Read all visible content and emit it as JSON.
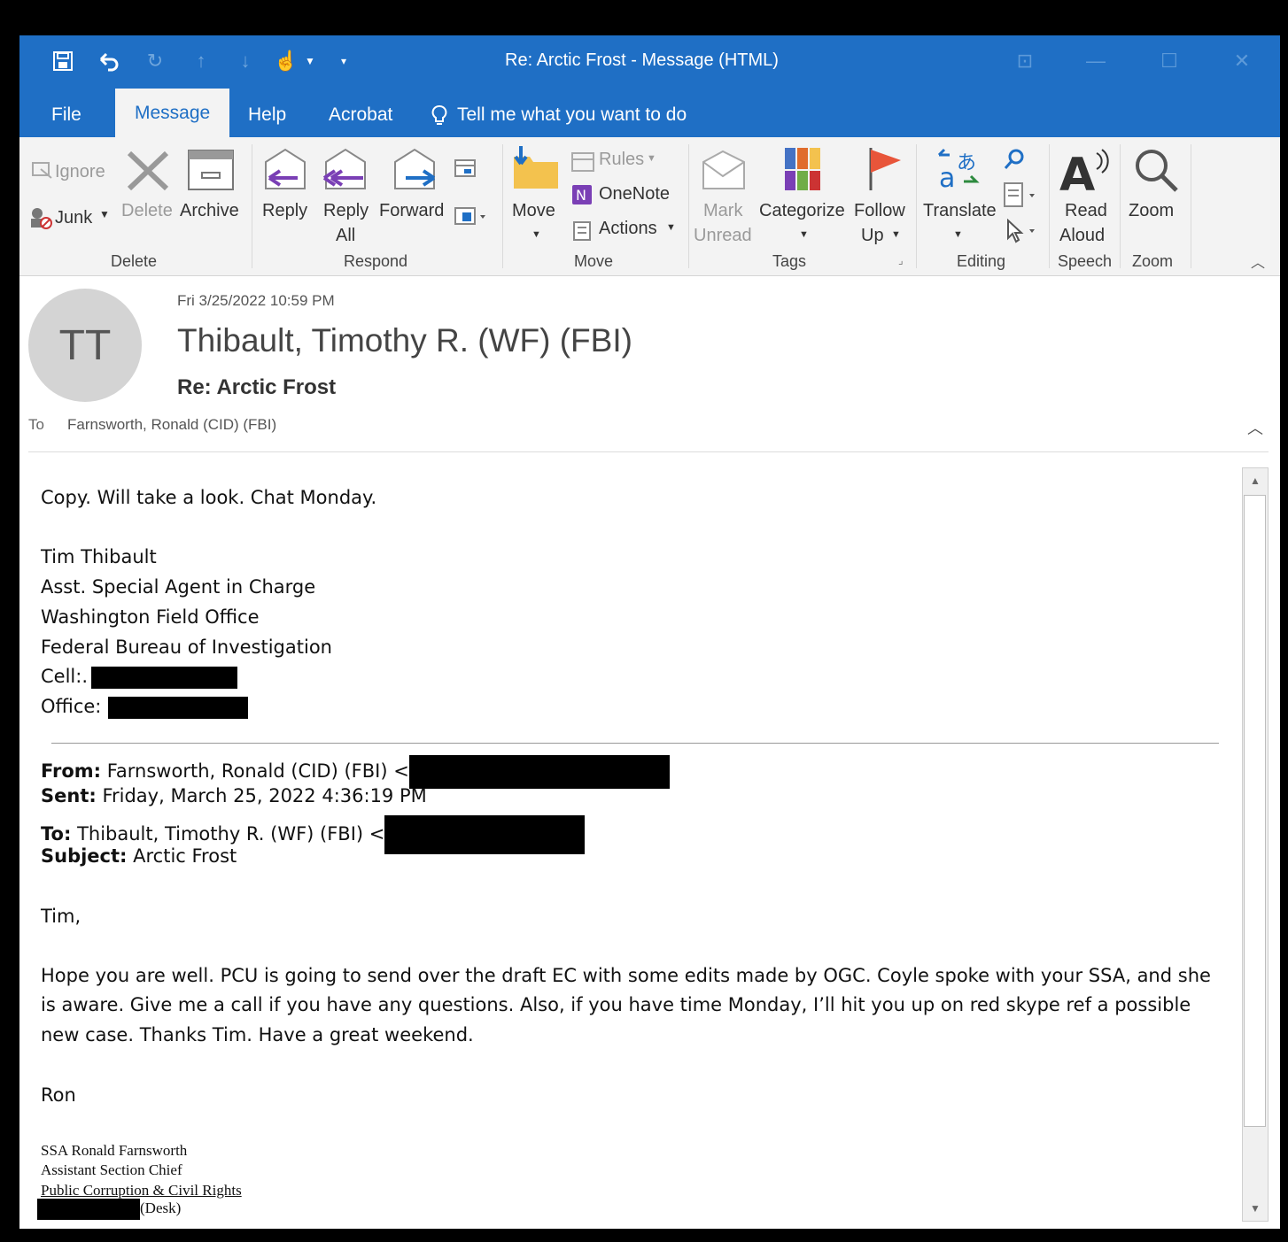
{
  "window": {
    "title": "Re: Arctic Frost  -  Message (HTML)",
    "quick_access": [
      "save-icon",
      "undo-icon",
      "redo-icon",
      "up-arrow-icon",
      "down-arrow-icon",
      "touch-mode-icon",
      "customize-icon"
    ]
  },
  "menu": {
    "file": "File",
    "message": "Message",
    "help": "Help",
    "acrobat": "Acrobat",
    "tell_me": "Tell me what you want to do"
  },
  "ribbon": {
    "delete_group": {
      "ignore": "Ignore",
      "junk": "Junk",
      "delete": "Delete",
      "archive": "Archive",
      "label": "Delete"
    },
    "respond_group": {
      "reply": "Reply",
      "reply_all_1": "Reply",
      "reply_all_2": "All",
      "forward": "Forward",
      "label": "Respond"
    },
    "move_group": {
      "move": "Move",
      "rules": "Rules",
      "onenote": "OneNote",
      "actions": "Actions",
      "label": "Move"
    },
    "tags_group": {
      "mark_1": "Mark",
      "mark_2": "Unread",
      "categorize": "Categorize",
      "follow_1": "Follow",
      "follow_2": "Up",
      "label": "Tags"
    },
    "editing_group": {
      "translate": "Translate",
      "label": "Editing"
    },
    "speech_group": {
      "read_1": "Read",
      "read_2": "Aloud",
      "label": "Speech"
    },
    "zoom_group": {
      "zoom": "Zoom",
      "label": "Zoom"
    }
  },
  "message": {
    "avatar_initials": "TT",
    "date": "Fri 3/25/2022 10:59 PM",
    "sender": "Thibault, Timothy R. (WF) (FBI)",
    "subject": "Re: Arctic Frost",
    "to_label": "To",
    "to_value": "Farnsworth, Ronald (CID) (FBI)"
  },
  "body": {
    "reply_line": "Copy.  Will take a look.  Chat Monday.",
    "sig": {
      "name": "Tim Thibault",
      "title": "Asst. Special Agent in Charge",
      "office": "Washington Field Office",
      "org": "Federal Bureau of Investigation",
      "cell_label": "Cell:.",
      "office_label": "Office:"
    },
    "quoted": {
      "from_label": "From:",
      "from_value": "Farnsworth, Ronald (CID) (FBI) <",
      "sent_label": "Sent:",
      "sent_value": "Friday, March 25, 2022 4:36:19 PM",
      "to_label": "To:",
      "to_value": "Thibault, Timothy R. (WF) (FBI) <",
      "subject_label": "Subject:",
      "subject_value": "Arctic Frost",
      "greeting": "Tim,",
      "para1": "Hope you are well.  PCU is going to send over the draft EC with some edits made by OGC.  Coyle spoke with your SSA, and she",
      "para2": "is aware.  Give me a call if you have any questions.  Also, if you have time Monday, I’ll hit you up on red skype ref a possible",
      "para3": "new case.  Thanks Tim.  Have a great weekend.",
      "closing": "Ron",
      "sig1": "SSA Ronald Farnsworth",
      "sig2": "Assistant Section Chief",
      "sig3": "Public Corruption & Civil Rights",
      "sig4": "(Desk)"
    }
  }
}
